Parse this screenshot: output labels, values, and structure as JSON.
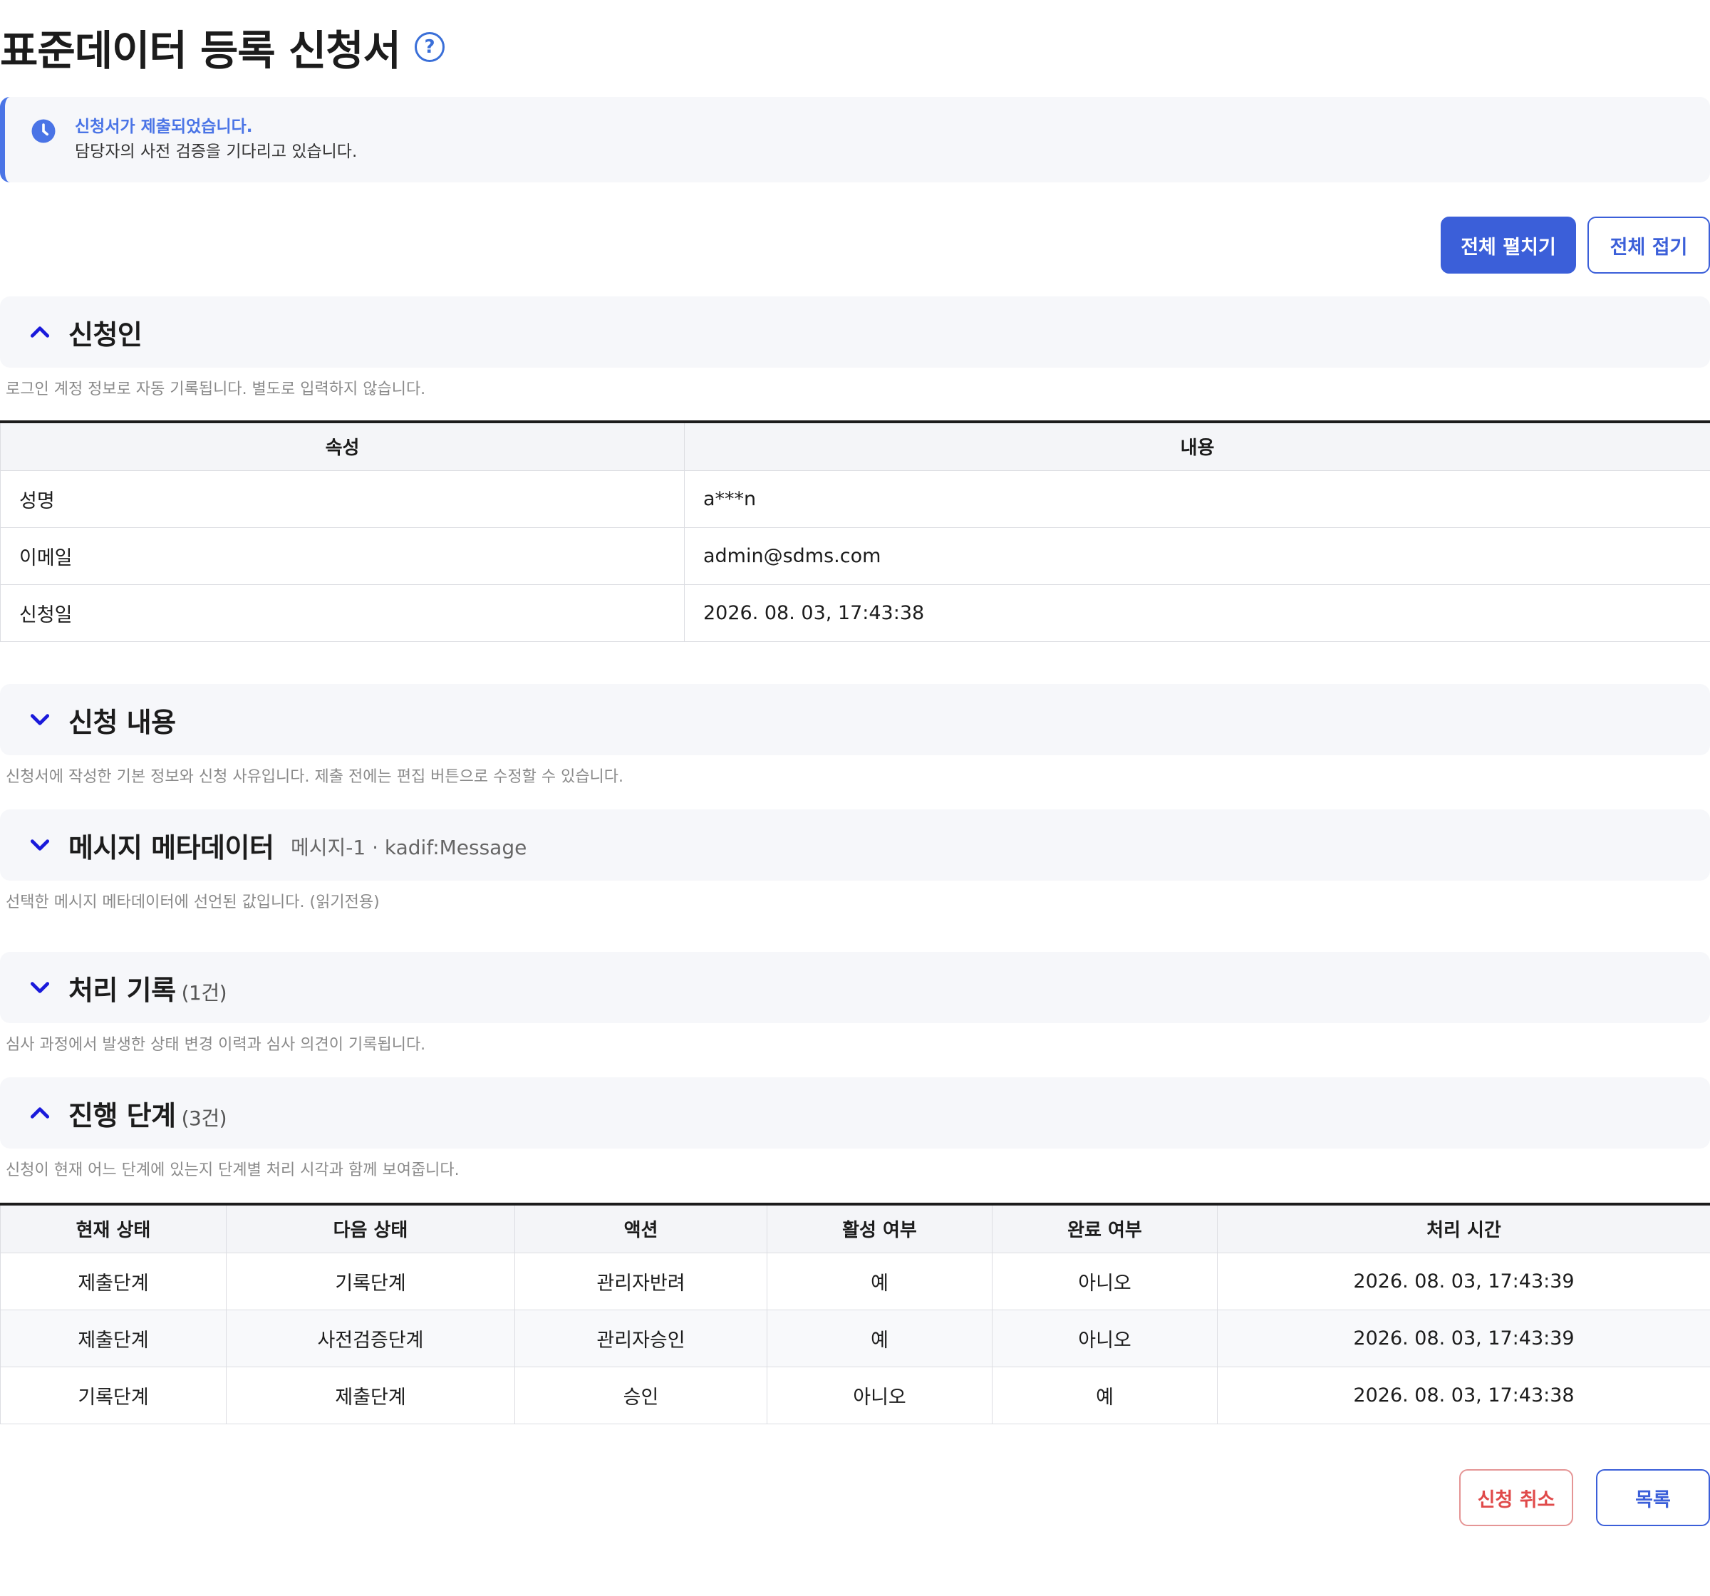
{
  "page": {
    "title": "표준데이터 등록 신청서",
    "help_icon": "question-circle-icon"
  },
  "notice": {
    "icon": "clock-icon",
    "title": "신청서가 제출되었습니다.",
    "desc": "담당자의 사전 검증을 기다리고 있습니다.",
    "accent": "#4a74e6"
  },
  "toolbar": {
    "expand_all": "전체 펼치기",
    "collapse_all": "전체 접기"
  },
  "sections": {
    "applicant": {
      "title": "신청인",
      "state": "expanded",
      "desc": "로그인 계정 정보로 자동 기록됩니다. 별도로 입력하지 않습니다.",
      "table": {
        "headers": [
          "속성",
          "내용"
        ],
        "rows": [
          [
            "성명",
            "a***n"
          ],
          [
            "이메일",
            "admin@sdms.com"
          ],
          [
            "신청일",
            "2026. 08. 03, 17:43:38"
          ]
        ]
      }
    },
    "content": {
      "title": "신청 내용",
      "state": "collapsed",
      "desc": "신청서에 작성한 기본 정보와 신청 사유입니다. 제출 전에는 편집 버튼으로 수정할 수 있습니다."
    },
    "metadata": {
      "title": "메시지 메타데이터",
      "state": "collapsed",
      "sub": "메시지-1 · kadif:Message",
      "desc": "선택한 메시지 메타데이터에 선언된 값입니다. (읽기전용)"
    },
    "history": {
      "title": "처리 기록",
      "state": "collapsed",
      "count": "(1건)",
      "desc": "심사 과정에서 발생한 상태 변경 이력과 심사 의견이 기록됩니다."
    },
    "steps": {
      "title": "진행 단계",
      "state": "expanded",
      "count": "(3건)",
      "desc": "신청이 현재 어느 단계에 있는지 단계별 처리 시각과 함께 보여줍니다.",
      "table": {
        "headers": [
          "현재 상태",
          "다음 상태",
          "액션",
          "활성 여부",
          "완료 여부",
          "처리 시간"
        ],
        "rows": [
          [
            "제출단계",
            "기록단계",
            "관리자반려",
            "예",
            "아니오",
            "2026. 08. 03, 17:43:39"
          ],
          [
            "제출단계",
            "사전검증단계",
            "관리자승인",
            "예",
            "아니오",
            "2026. 08. 03, 17:43:39"
          ],
          [
            "기록단계",
            "제출단계",
            "승인",
            "아니오",
            "예",
            "2026. 08. 03, 17:43:38"
          ]
        ]
      }
    }
  },
  "footer": {
    "cancel": "신청 취소",
    "list": "목록"
  },
  "colors": {
    "primary": "#3b5fd9",
    "danger": "#e04a4a",
    "chevron": "#1a1adb"
  }
}
